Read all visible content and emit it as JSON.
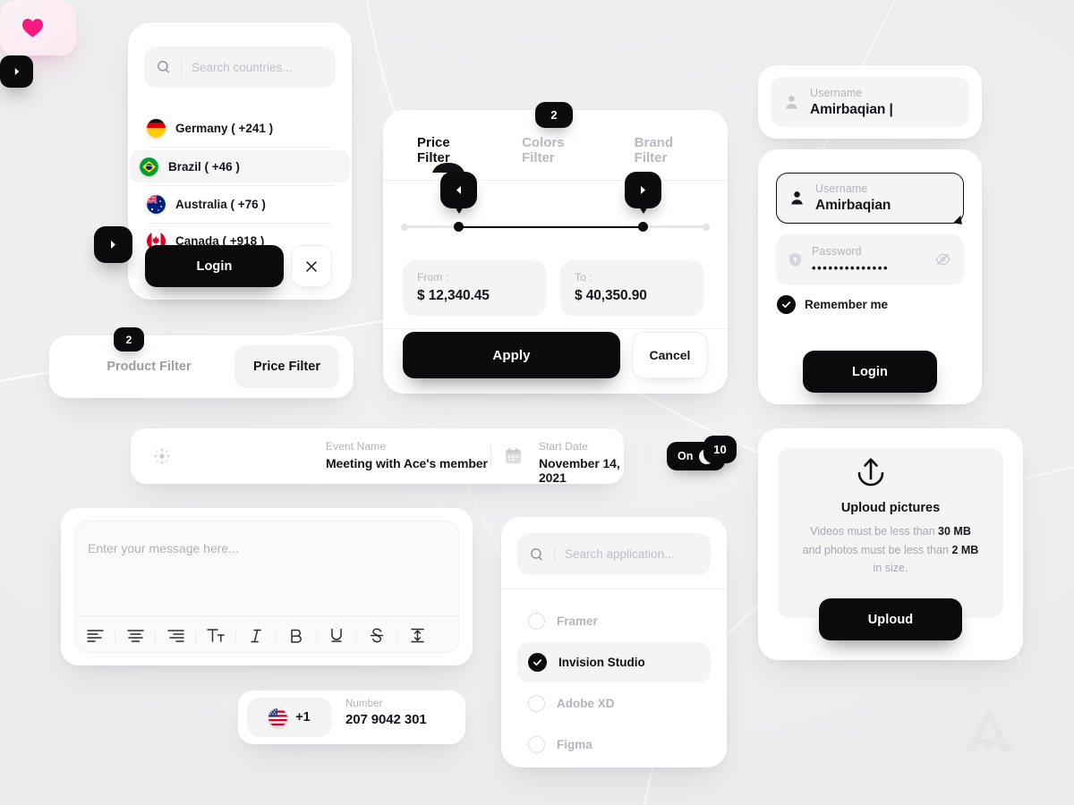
{
  "theme": {
    "background": "#eeeeef",
    "card_bg": "#ffffff",
    "inner_bg": "#f4f4f5",
    "accent_dark": "#0b0b0d",
    "muted_text": "#b4b4ba",
    "heart_pink": "#f6177f"
  },
  "countries_card": {
    "search": {
      "placeholder": "Search countries...",
      "icon": "search-icon"
    },
    "items": [
      {
        "label": "Germany ( +241 )",
        "flag": "de",
        "selected": false
      },
      {
        "label": "Brazil ( +46 )",
        "flag": "br",
        "selected": true
      },
      {
        "label": "Australia ( +76 )",
        "flag": "au",
        "selected": false
      },
      {
        "label": "Canada ( +918 )",
        "flag": "ca",
        "selected": false
      }
    ],
    "login_label": "Login",
    "close_label": "×"
  },
  "price_filter": {
    "badge": "2",
    "tabs": [
      {
        "label": "Price Filter",
        "active": true
      },
      {
        "label": "Colors Filter",
        "active": false
      },
      {
        "label": "Brand Filter",
        "active": false
      }
    ],
    "slider": {
      "left_glyph": "◀",
      "right_glyph": "▶"
    },
    "from": {
      "label": "From :",
      "value": "$ 12,340.45"
    },
    "to": {
      "label": "To :",
      "value": "$ 40,350.90"
    },
    "apply_label": "Apply",
    "cancel_label": "Cancel"
  },
  "username_pill": {
    "label": "Username",
    "value": "Amirbaqian |",
    "icon": "user-icon"
  },
  "login_card": {
    "username": {
      "label": "Username",
      "value": "Amirbaqian",
      "icon": "user-icon"
    },
    "password": {
      "label": "Password",
      "value": "••••••••••••••",
      "icon": "shield-icon",
      "toggle_icon": "eye-off-icon"
    },
    "remember_label": "Remember me",
    "remember_checked": true,
    "login_label": "Login"
  },
  "product_filter": {
    "badge": "2",
    "tabs": [
      {
        "label": "Product Filter",
        "active": false
      },
      {
        "label": "Price Filter",
        "active": true
      }
    ]
  },
  "event_bar": {
    "drag_icon": "drag-handle-icon",
    "name": {
      "label": "Event Name",
      "value": "Meeting with Ace's member"
    },
    "date": {
      "label": "Start Date",
      "value": "November 14, 2021",
      "icon": "calendar-icon"
    },
    "toggle": {
      "label": "On",
      "state": true
    }
  },
  "like_widget": {
    "icon": "heart-icon",
    "count": "10"
  },
  "message_editor": {
    "placeholder": "Enter your message here...",
    "toolbar": [
      {
        "name": "align-left-icon"
      },
      {
        "name": "align-center-icon"
      },
      {
        "name": "align-right-icon"
      },
      {
        "name": "text-size-icon"
      },
      {
        "name": "italic-icon"
      },
      {
        "name": "bold-icon"
      },
      {
        "name": "underline-icon"
      },
      {
        "name": "strikethrough-icon"
      },
      {
        "name": "line-height-icon"
      }
    ]
  },
  "app_picker": {
    "search": {
      "placeholder": "Search application...",
      "icon": "search-icon"
    },
    "options": [
      {
        "label": "Framer",
        "selected": false
      },
      {
        "label": "Invision Studio",
        "selected": true
      },
      {
        "label": "Adobe XD",
        "selected": false
      },
      {
        "label": "Figma",
        "selected": false
      }
    ],
    "next_glyph": "▶"
  },
  "upload_card": {
    "icon": "upload-icon",
    "title": "Uploud pictures",
    "desc_line1_pre": "Videos must be less than ",
    "desc_line1_bold": "30 MB",
    "desc_line2_pre": "and photos must be less than ",
    "desc_line2_bold": "2 MB",
    "desc_line3": "in size.",
    "button_label": "Uploud"
  },
  "phone_input": {
    "flag": "us",
    "country_code": "+1",
    "label": "Number",
    "value": "207 9042 301",
    "next_glyph": "▶"
  },
  "watermark": {
    "name": "brand-logo-watermark"
  }
}
